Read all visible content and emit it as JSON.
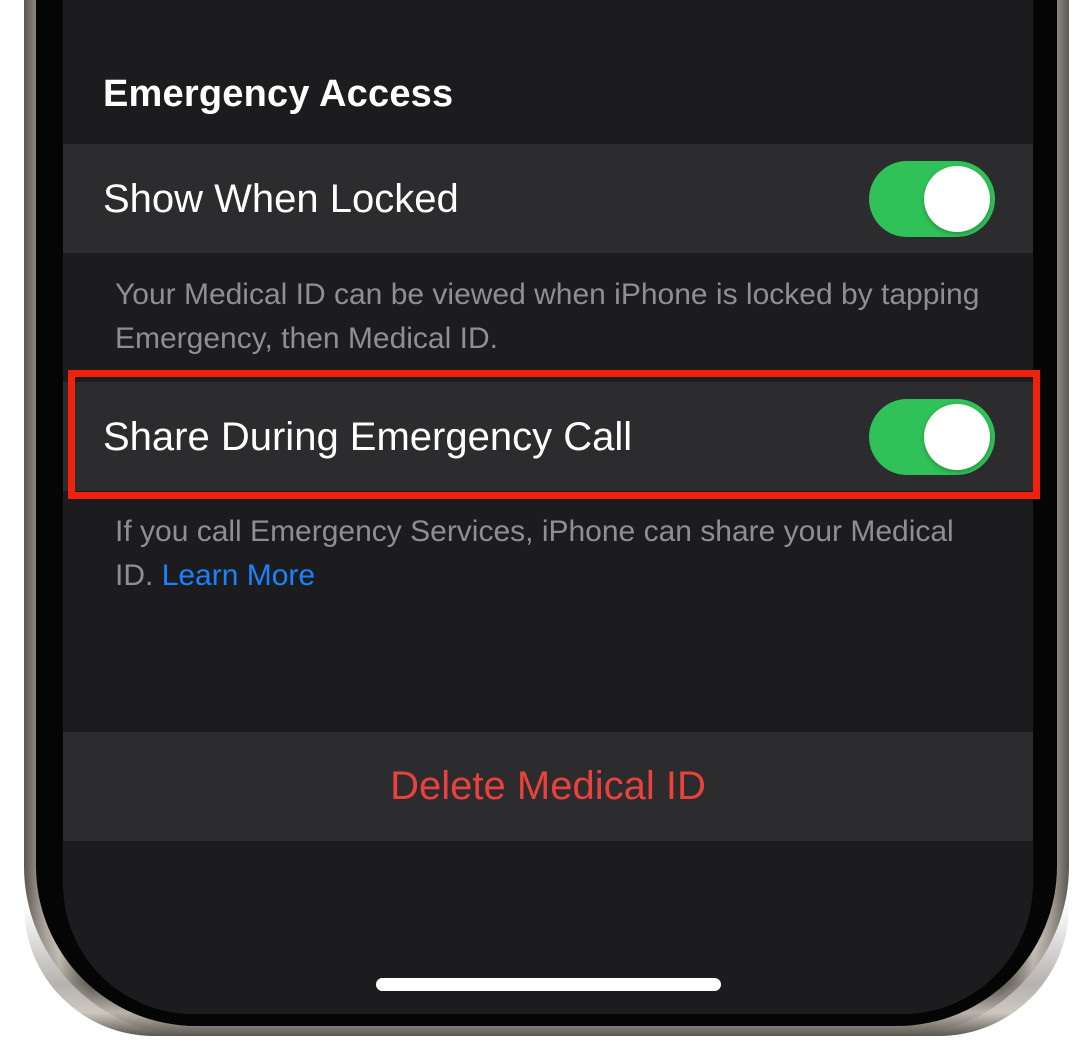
{
  "emergency_access": {
    "header": "Emergency Access",
    "show_when_locked": {
      "label": "Show When Locked",
      "enabled": true,
      "footnote": "Your Medical ID can be viewed when iPhone is locked by tapping Emergency, then Medical ID."
    },
    "share_during_call": {
      "label": "Share During Emergency Call",
      "enabled": true,
      "footnote": "If you call Emergency Services, iPhone can share your Medical ID.",
      "link": "Learn More"
    }
  },
  "delete": {
    "label": "Delete Medical ID"
  },
  "colors": {
    "background": "#1c1c1e",
    "row": "#2c2c2e",
    "toggle_on": "#30c158",
    "destructive": "#e8423c",
    "link": "#1a82ff",
    "highlight": "#f0220d"
  }
}
